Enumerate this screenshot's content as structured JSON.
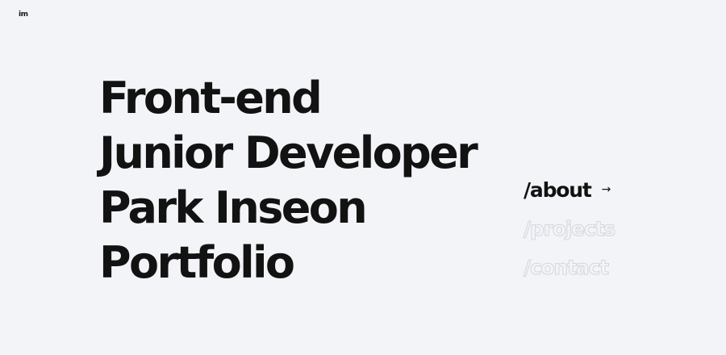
{
  "logo": {
    "text": "im"
  },
  "hero": {
    "lines": [
      "Front-end",
      "Junior Developer",
      "Park Inseon",
      "Portfolio"
    ]
  },
  "nav": {
    "items": [
      {
        "label": "/about",
        "active": true,
        "arrow": "→"
      },
      {
        "label": "/projects",
        "active": false
      },
      {
        "label": "/contact",
        "active": false
      }
    ]
  },
  "colors": {
    "background": "#f3f4f8",
    "text": "#121212",
    "outline_stroke": "#d4d6dc"
  }
}
